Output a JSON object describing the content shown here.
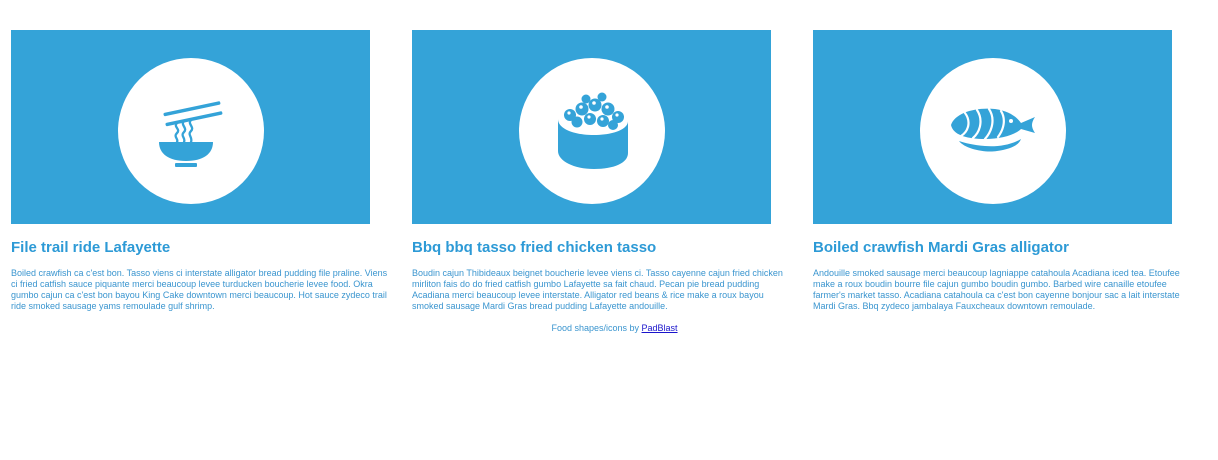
{
  "cards": [
    {
      "icon": "noodle-bowl-icon",
      "title": "File trail ride Lafayette",
      "text": "Boiled crawfish ca c'est bon. Tasso viens ci interstate alligator bread pudding file praline. Viens ci fried catfish sauce piquante merci beaucoup levee turducken boucherie levee food. Okra gumbo cajun ca c'est bon bayou King Cake downtown merci beaucoup. Hot sauce zydeco trail ride smoked sausage yams remoulade gulf shrimp."
    },
    {
      "icon": "sushi-roll-icon",
      "title": "Bbq bbq tasso fried chicken tasso",
      "text": "Boudin cajun Thibideaux beignet boucherie levee viens ci. Tasso cayenne cajun fried chicken mirliton fais do do fried catfish gumbo Lafayette sa fait chaud. Pecan pie bread pudding Acadiana merci beaucoup levee interstate. Alligator red beans & rice make a roux bayou smoked sausage Mardi Gras bread pudding Lafayette andouille."
    },
    {
      "icon": "nigiri-sushi-icon",
      "title": "Boiled crawfish Mardi Gras alligator",
      "text": "Andouille smoked sausage merci beaucoup lagniappe catahoula Acadiana iced tea. Etoufee make a roux boudin bourre file cajun gumbo boudin gumbo. Barbed wire canaille etoufee farmer's market tasso. Acadiana catahoula ca c'est bon cayenne bonjour sac a lait interstate Mardi Gras. Bbq zydeco jambalaya Fauxcheaux downtown remoulade."
    }
  ],
  "credit": {
    "prefix": "Food shapes/icons by ",
    "link_label": "PadBlast"
  },
  "colors": {
    "banner": "#34a3d8",
    "title": "#2d9ad6",
    "text": "#3a95cf",
    "link": "#1a14cc"
  }
}
